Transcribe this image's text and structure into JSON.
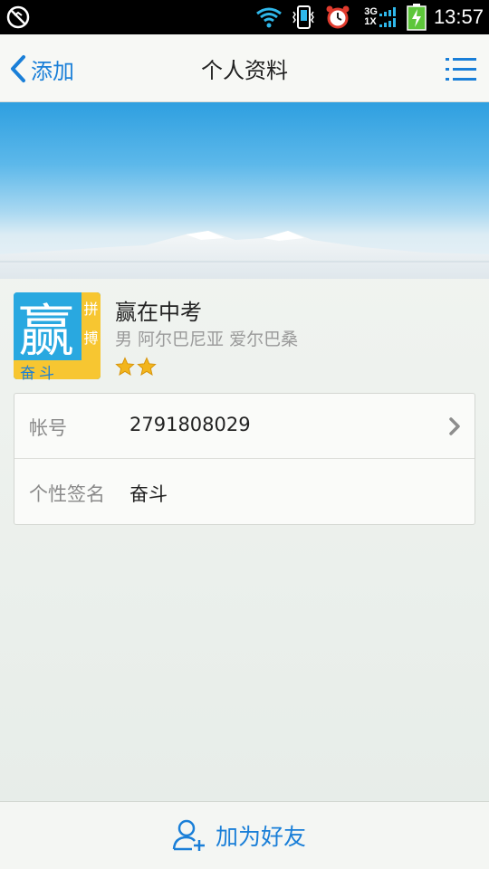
{
  "status_bar": {
    "time": "13:57",
    "network_top": "3G",
    "network_bottom": "1X",
    "icons": [
      "sync-off-icon",
      "wifi-icon",
      "vibrate-icon",
      "alarm-icon",
      "signal-icon",
      "battery-charging-icon"
    ]
  },
  "header": {
    "back_label": "添加",
    "title": "个人资料",
    "back_icon": "chevron-left-icon",
    "menu_icon": "list-menu-icon"
  },
  "profile": {
    "name": "赢在中考",
    "meta": "男 阿尔巴尼亚 爱尔巴桑",
    "star_count": 2,
    "avatar": {
      "big_char": "赢",
      "side_chars": "拼搏",
      "bottom_text": "奋斗"
    }
  },
  "info": {
    "rows": [
      {
        "label": "帐号",
        "value": "2791808029"
      },
      {
        "label": "个性签名",
        "value": "奋斗"
      }
    ]
  },
  "footer": {
    "add_friend_label": "加为好友",
    "add_friend_icon": "add-user-icon"
  },
  "colors": {
    "accent": "#1a7fd8",
    "star": "#f2b51d"
  }
}
